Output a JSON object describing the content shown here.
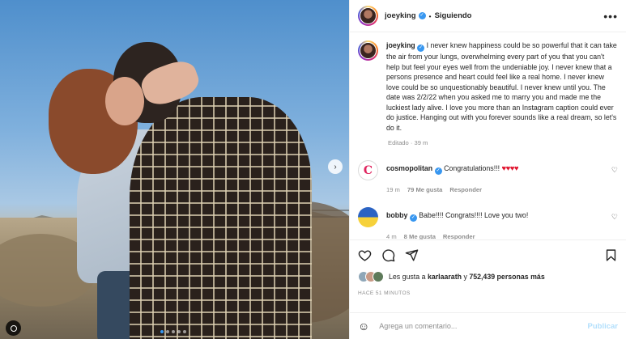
{
  "post": {
    "author": "joeyking",
    "follow_status": "Siguiendo",
    "separator": "•",
    "more": "•••",
    "caption": "I never knew happiness could be so powerful that it can take the air from your lungs, overwhelming every part of you that you can't help but feel your eyes well from the undeniable joy. I never knew that a persons presence and heart could feel like a real home. I never knew love could be so unquestionably beautiful. I never knew until you. The date was 2/2/22 when you asked me to marry you and made me the luckiest lady alive. I love you more than an Instagram caption could ever do justice. Hanging out with you forever sounds like a real dream, so let's do it.",
    "edited_label": "Editado · 39 m"
  },
  "comments": [
    {
      "user": "cosmopolitan",
      "avatar_letter": "C",
      "text": "Congratulations!!!",
      "hearts": "♥♥♥♥",
      "time": "19 m",
      "likes": "79 Me gusta",
      "reply": "Responder"
    },
    {
      "user": "bobby",
      "text": "Babe!!!! Congrats!!!! Love you two!",
      "time": "4 m",
      "likes": "8 Me gusta",
      "reply": "Responder"
    }
  ],
  "likes": {
    "prefix": "Les gusta a",
    "user": "karlaarath",
    "joiner": "y",
    "count": "752,439 personas más"
  },
  "timestamp": "Hace 51 minutos",
  "add_comment": {
    "placeholder": "Agrega un comentario...",
    "publish": "Publicar"
  },
  "carousel": {
    "slides": 5,
    "active": 1
  },
  "colors": {
    "accent": "#3897f0",
    "publish_disabled": "#b2dffc",
    "heart_red": "#e0142e"
  }
}
